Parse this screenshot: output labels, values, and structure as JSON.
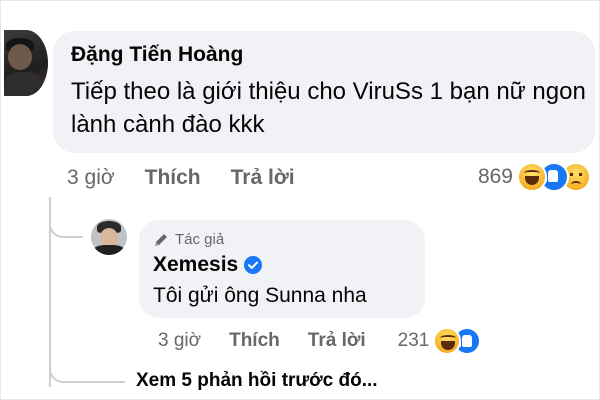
{
  "comment": {
    "author": "Đặng Tiến Hoàng",
    "text": "Tiếp theo là giới thiệu cho ViruSs 1 bạn nữ ngon lành cành đào kkk",
    "time": "3 giờ",
    "like_label": "Thích",
    "reply_label": "Trả lời",
    "reaction_count": "869",
    "reactions": [
      "haha",
      "like",
      "sad"
    ]
  },
  "reply": {
    "badge": "Tác giả",
    "author": "Xemesis",
    "verified": true,
    "text": "Tôi gửi ông Sunna nha",
    "time": "3 giờ",
    "like_label": "Thích",
    "reply_label": "Trả lời",
    "reaction_count": "231",
    "reactions": [
      "haha",
      "like"
    ]
  },
  "view_more": "Xem 5 phản hồi trước đó...",
  "colors": {
    "bubble": "#f0f2f5",
    "secondary_text": "#65676b",
    "primary_text": "#050505",
    "like_blue": "#1877f2",
    "emoji_yellow": "#f7b125",
    "thread_line": "#ccd0d5"
  }
}
